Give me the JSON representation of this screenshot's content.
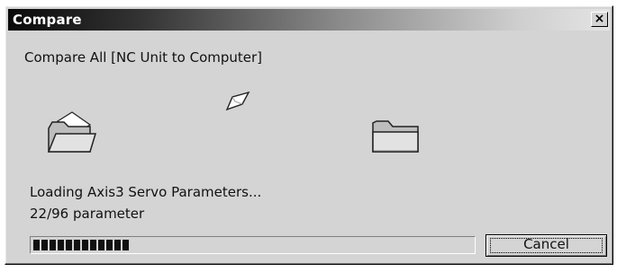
{
  "window": {
    "title": "Compare",
    "close_glyph": "×"
  },
  "dialog": {
    "heading": "Compare All [NC Unit to Computer]",
    "status": "Loading Axis3 Servo Parameters...",
    "count": "22/96 parameter",
    "progress": {
      "current": 22,
      "total": 96,
      "percent": 23
    },
    "cancel_label": "Cancel"
  },
  "icons": {
    "source": "open-folder-icon",
    "flying": "flying-paper-icon",
    "destination": "closed-folder-icon"
  }
}
